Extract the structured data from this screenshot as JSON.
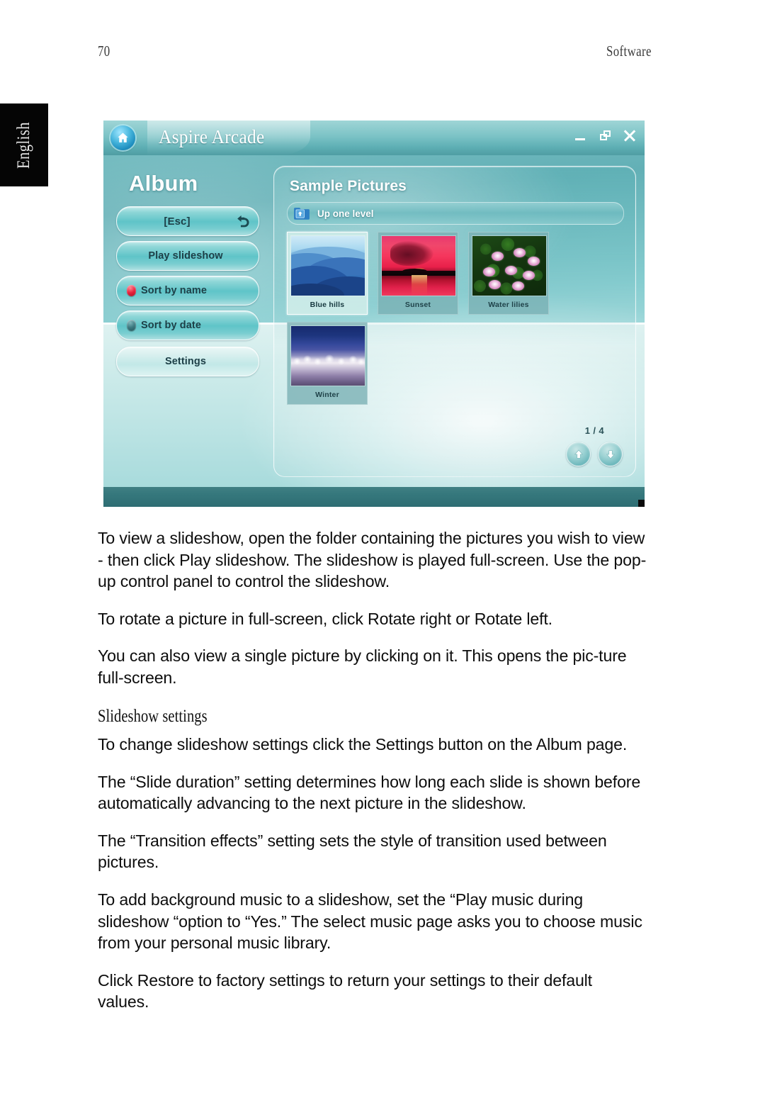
{
  "page": {
    "number": "70",
    "section": "Software",
    "language_tab": "English"
  },
  "screenshot": {
    "titlebar": {
      "app_title": "Aspire Arcade",
      "home_icon": "home-icon",
      "minimize_label": "minimize",
      "restore_label": "restore",
      "close_label": "close"
    },
    "left_panel": {
      "heading": "Album",
      "buttons": [
        {
          "label": "[Esc]",
          "icon": "back-arrow-icon",
          "indicator": "none",
          "style": "esc"
        },
        {
          "label": "Play slideshow",
          "icon": "none",
          "indicator": "none",
          "style": "center"
        },
        {
          "label": "Sort by name",
          "icon": "none",
          "indicator": "on",
          "style": "led"
        },
        {
          "label": "Sort by date",
          "icon": "none",
          "indicator": "off",
          "style": "led"
        },
        {
          "label": "Settings",
          "icon": "none",
          "indicator": "none",
          "style": "light"
        }
      ]
    },
    "content_panel": {
      "folder_title": "Sample Pictures",
      "up_one_level": {
        "label": "Up one level",
        "icon": "folder-up-icon"
      },
      "thumbnails": [
        {
          "caption": "Blue hills",
          "art": "bluehills",
          "selected": true
        },
        {
          "caption": "Sunset",
          "art": "sunset",
          "selected": false
        },
        {
          "caption": "Water lilies",
          "art": "lilies",
          "selected": false
        },
        {
          "caption": "Winter",
          "art": "winter",
          "selected": false
        }
      ],
      "pager": {
        "count": "1 / 4",
        "up_icon": "arrow-up-icon",
        "down_icon": "arrow-down-icon"
      }
    },
    "colors": {
      "shell_teal": "#6fb8bd",
      "title_text": "#ffffff",
      "button_text": "#1d3f47",
      "led_active": "#e8213c",
      "led_inactive": "#3d7a81"
    }
  },
  "body": {
    "paragraphs": [
      "To view a slideshow, open the folder containing the pictures you wish to view - then click  Play slideshow. The slideshow is played full-screen. Use the pop-up control panel to control the slideshow.",
      "To rotate a picture in full-screen, click  Rotate right or Rotate left.",
      "You can also view a single picture by clicking on it. This opens the pic-ture full-screen."
    ],
    "subheading": "Slideshow settings",
    "paragraphs_after": [
      "To change slideshow settings click the Settings button on the Album page.",
      "The “Slide duration” setting determines how long each slide is shown before automatically advancing to the next picture in the slideshow.",
      "The “Transition effects” setting sets the style of transition used between pictures.",
      "To add background music to a slideshow, set the “Play music during slideshow “option to “Yes.” The select music page asks you to choose music from your personal music library.",
      "Click Restore to factory settings to return your settings to their default values."
    ]
  }
}
